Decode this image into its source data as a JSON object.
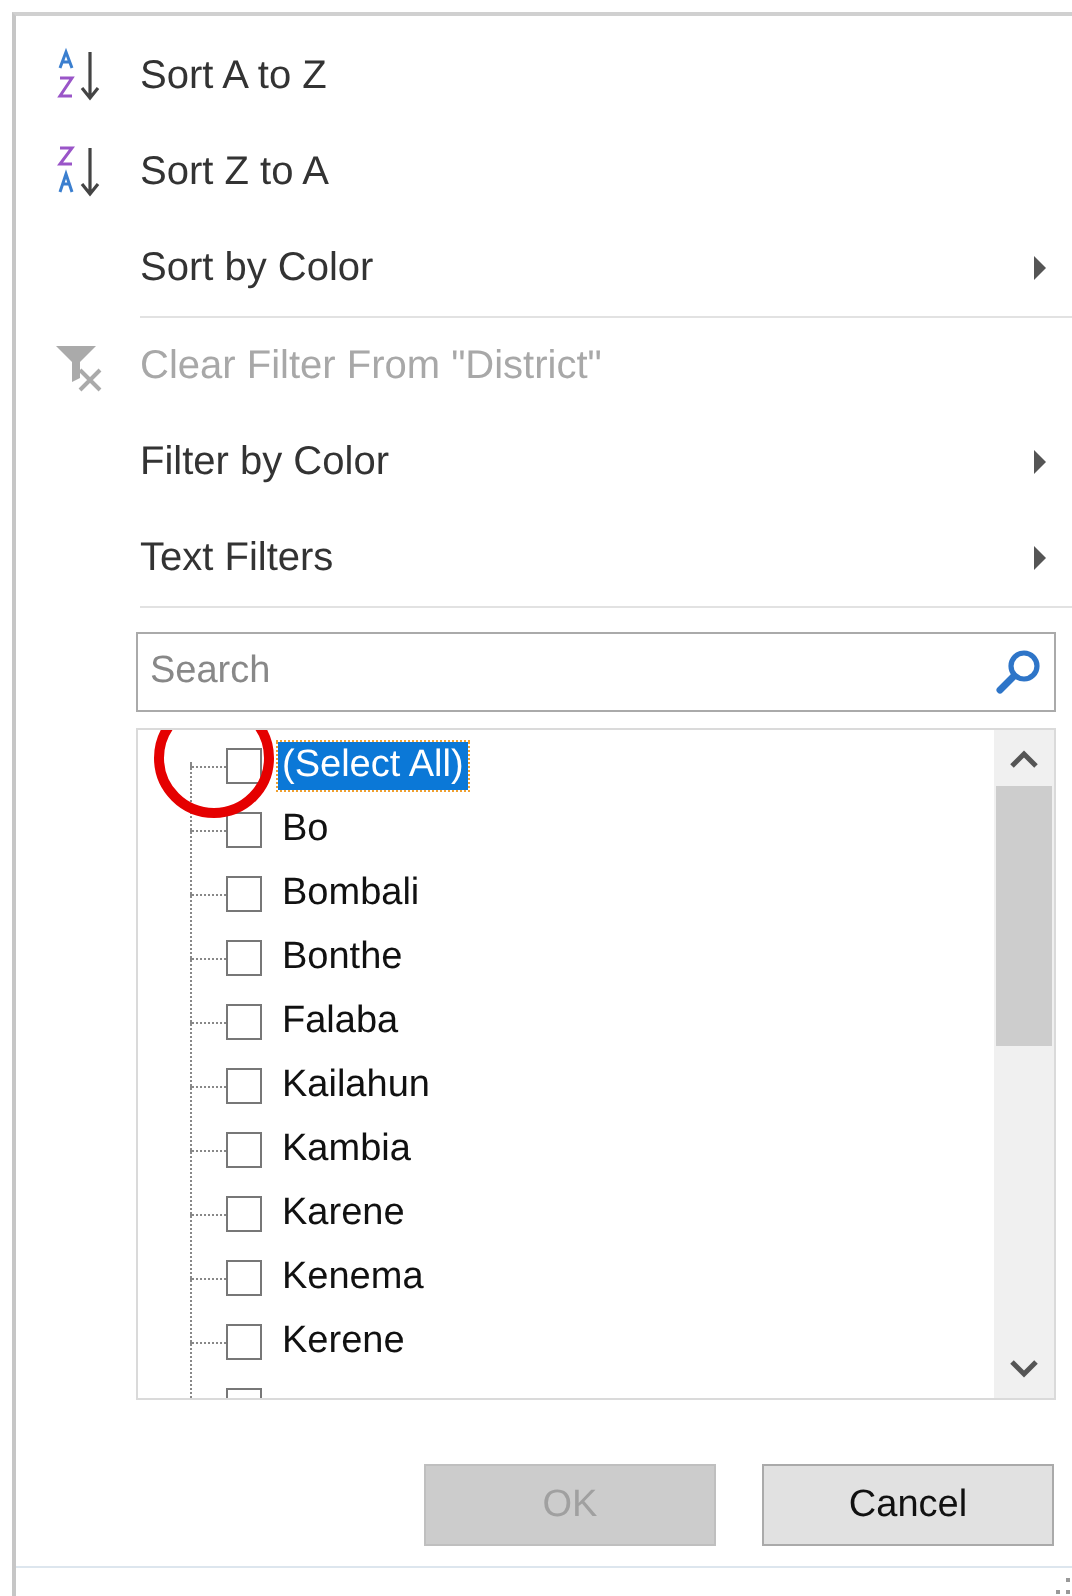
{
  "menu_groups": [
    [
      {
        "label": "Sort A to Z",
        "kind": "sort-ascending",
        "disabled": false,
        "submenu": false
      },
      {
        "label": "Sort Z to A",
        "kind": "sort-descending",
        "disabled": false,
        "submenu": false
      },
      {
        "label": "Sort by Color",
        "kind": "plain",
        "disabled": false,
        "submenu": true
      }
    ],
    [
      {
        "label": "Clear Filter From \"District\"",
        "kind": "clear-filter",
        "disabled": true,
        "submenu": false
      },
      {
        "label": "Filter by Color",
        "kind": "plain",
        "disabled": false,
        "submenu": true
      },
      {
        "label": "Text Filters",
        "kind": "plain",
        "disabled": false,
        "submenu": true
      }
    ]
  ],
  "search": {
    "placeholder": "Search"
  },
  "values": [
    {
      "label": "(Select All)",
      "checked": false,
      "selected": true
    },
    {
      "label": "Bo",
      "checked": false,
      "selected": false
    },
    {
      "label": "Bombali",
      "checked": false,
      "selected": false
    },
    {
      "label": "Bonthe",
      "checked": false,
      "selected": false
    },
    {
      "label": "Falaba",
      "checked": false,
      "selected": false
    },
    {
      "label": "Kailahun",
      "checked": false,
      "selected": false
    },
    {
      "label": "Kambia",
      "checked": false,
      "selected": false
    },
    {
      "label": "Karene",
      "checked": false,
      "selected": false
    },
    {
      "label": "Kenema",
      "checked": false,
      "selected": false
    },
    {
      "label": "Kerene",
      "checked": false,
      "selected": false
    }
  ],
  "buttons": [
    {
      "label": "OK",
      "disabled": true
    },
    {
      "label": "Cancel",
      "disabled": false
    }
  ]
}
